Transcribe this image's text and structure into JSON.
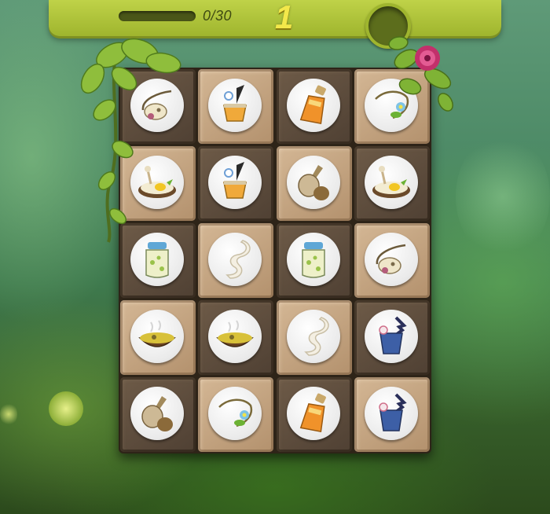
{
  "hud": {
    "progress_text": "0/30",
    "progress_fraction": 0,
    "level": "1"
  },
  "board": {
    "rows": 5,
    "cols": 4,
    "tiles": [
      {
        "shade": "dark",
        "item": "bone-icon"
      },
      {
        "shade": "light",
        "item": "quill-pot-icon"
      },
      {
        "shade": "dark",
        "item": "potion-vial-icon"
      },
      {
        "shade": "light",
        "item": "flower-wand-icon"
      },
      {
        "shade": "light",
        "item": "egg-plate-icon"
      },
      {
        "shade": "dark",
        "item": "quill-pot-icon"
      },
      {
        "shade": "light",
        "item": "gourd-bottle-icon"
      },
      {
        "shade": "dark",
        "item": "egg-plate-icon"
      },
      {
        "shade": "dark",
        "item": "jar-icon"
      },
      {
        "shade": "light",
        "item": "scroll-icon"
      },
      {
        "shade": "dark",
        "item": "jar-icon"
      },
      {
        "shade": "light",
        "item": "bone-icon"
      },
      {
        "shade": "light",
        "item": "soup-bowl-icon"
      },
      {
        "shade": "dark",
        "item": "soup-bowl-icon"
      },
      {
        "shade": "light",
        "item": "scroll-icon"
      },
      {
        "shade": "dark",
        "item": "magic-glass-icon"
      },
      {
        "shade": "dark",
        "item": "gourd-bottle-icon"
      },
      {
        "shade": "light",
        "item": "flower-wand-icon"
      },
      {
        "shade": "dark",
        "item": "potion-vial-icon"
      },
      {
        "shade": "light",
        "item": "magic-glass-icon"
      }
    ]
  },
  "colors": {
    "hud_green": "#aec23a",
    "level_yellow": "#f3e84a",
    "tile_light": "#c7a782",
    "tile_dark": "#5e4d3d"
  }
}
